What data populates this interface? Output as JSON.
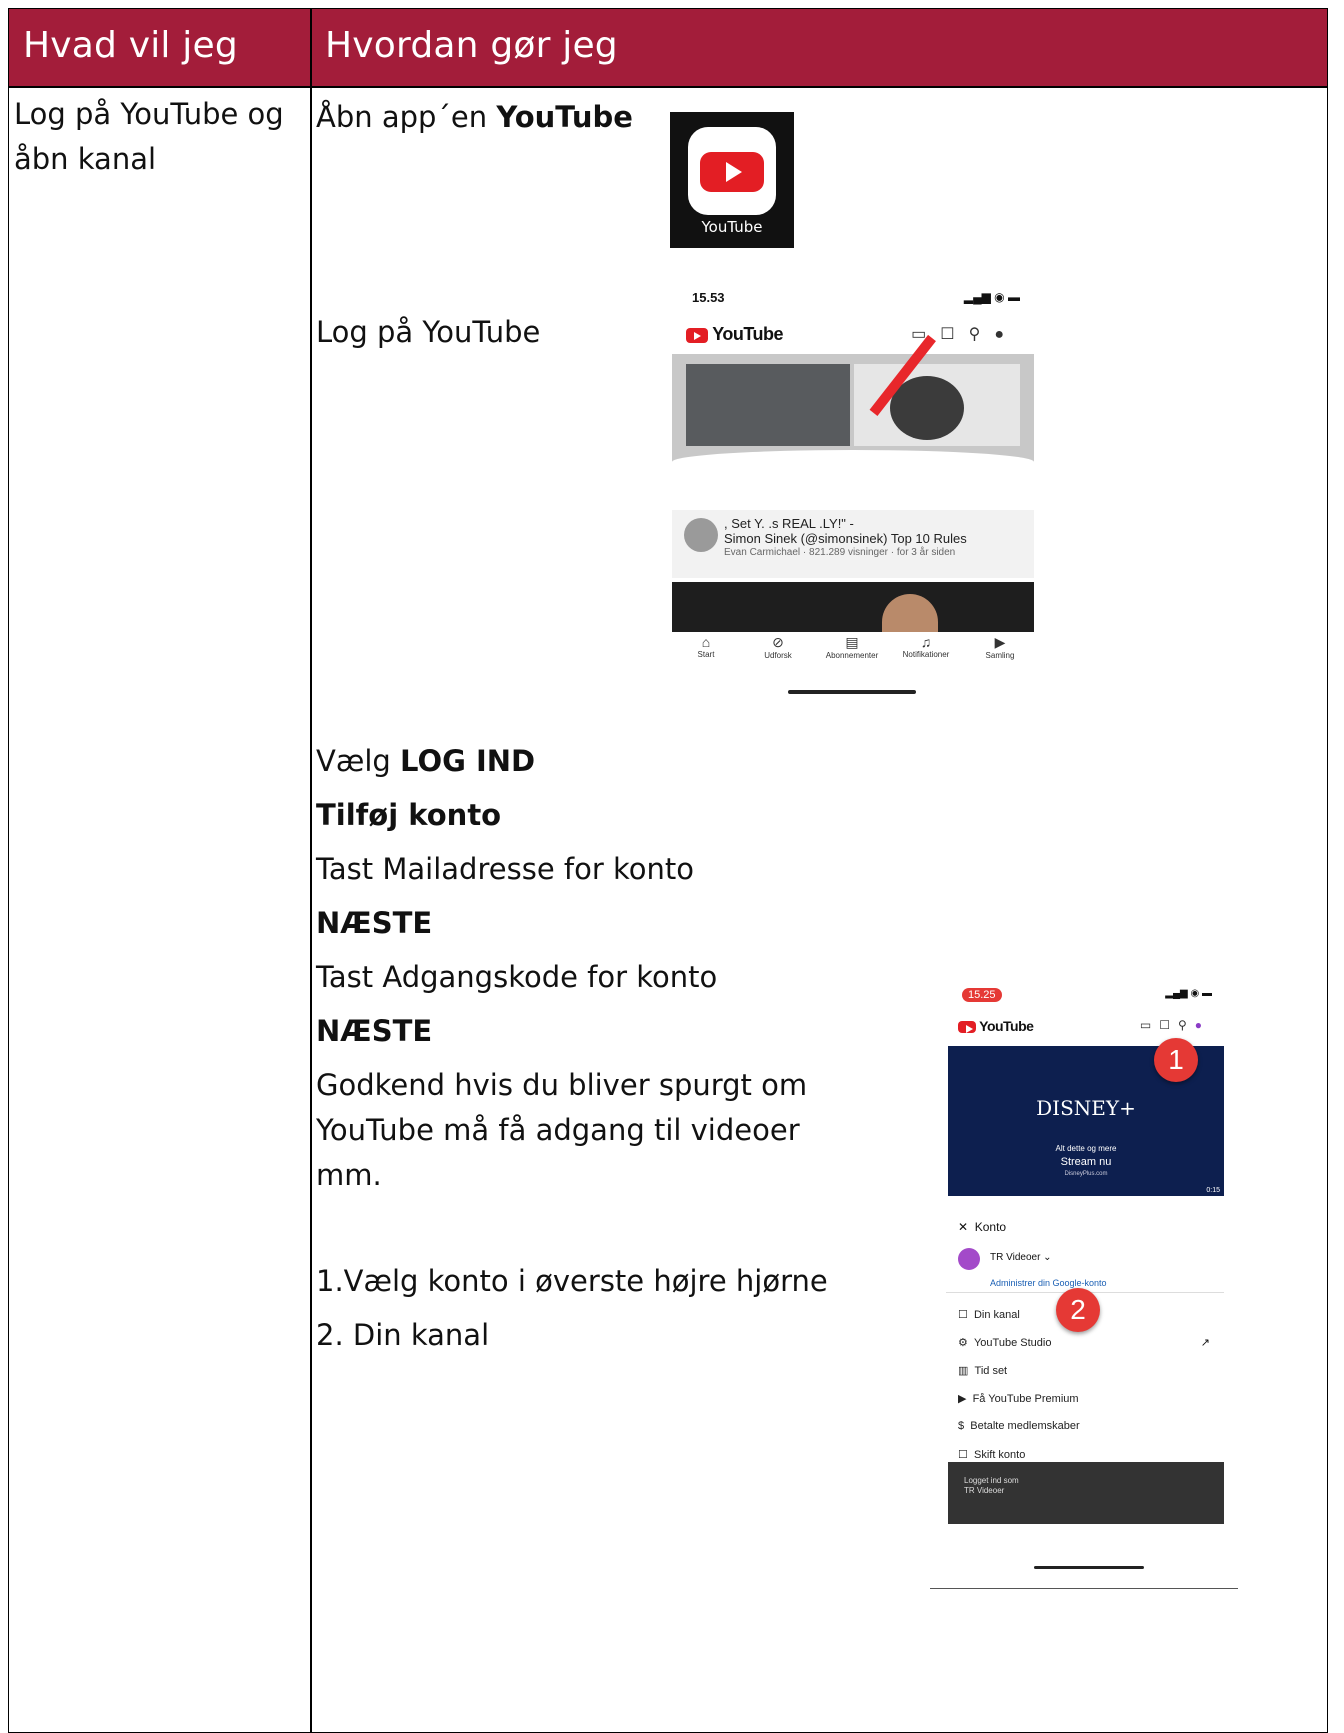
{
  "header": {
    "col1": "Hvad vil jeg",
    "col2": "Hvordan gør jeg"
  },
  "left": {
    "task": "Log på YouTube og åbn kanal"
  },
  "steps": {
    "open_prefix": "Åbn app´en ",
    "open_app": "YouTube",
    "login": "Log på YouTube",
    "choose_prefix": "Vælg ",
    "choose_bold": "LOG IND",
    "add_account": "Tilføj konto",
    "mail": "Tast Mailadresse for konto",
    "next1": "NÆSTE",
    "password": "Tast Adgangskode for konto",
    "next2": "NÆSTE",
    "approve1": "Godkend hvis du bliver spurgt om",
    "approve2": "YouTube må få adgang til videoer",
    "approve3": "mm.",
    "choose_account": "1.Vælg konto i øverste højre hjørne",
    "your_channel": "2. Din kanal"
  },
  "app_icon": {
    "caption": "YouTube"
  },
  "phone1": {
    "time": "15.53",
    "logo": "YouTube",
    "video_title_1": ", Set Y.      .s REAL       .LY!\" -",
    "video_title_2": "Simon Sinek (@simonsinek) Top 10 Rules",
    "video_meta": "Evan Carmichael · 821.289 visninger · for 3 år siden",
    "nav": [
      "Start",
      "Udforsk",
      "Abonnementer",
      "Notifikationer",
      "Samling"
    ]
  },
  "phone2": {
    "time": "15.25",
    "logo": "YouTube",
    "promo_brand": "DISNEY+",
    "promo_line1": "Alt dette og mere",
    "promo_line2": "Stream nu",
    "promo_url": "DisneyPlus.com",
    "duration": "0:15",
    "menu_title": "Konto",
    "account_name": "TR Videoer",
    "manage": "Administrer din Google-konto",
    "menu": [
      "Din kanal",
      "YouTube Studio",
      "Tid set",
      "Få YouTube Premium",
      "Betalte medlemskaber",
      "Skift konto"
    ],
    "toast1": "Logget ind som",
    "toast2": "TR Videoer",
    "badge1": "1",
    "badge2": "2"
  },
  "colors": {
    "header_bg": "#a31d3a",
    "youtube_red": "#e31e24",
    "badge_red": "#e53935"
  }
}
